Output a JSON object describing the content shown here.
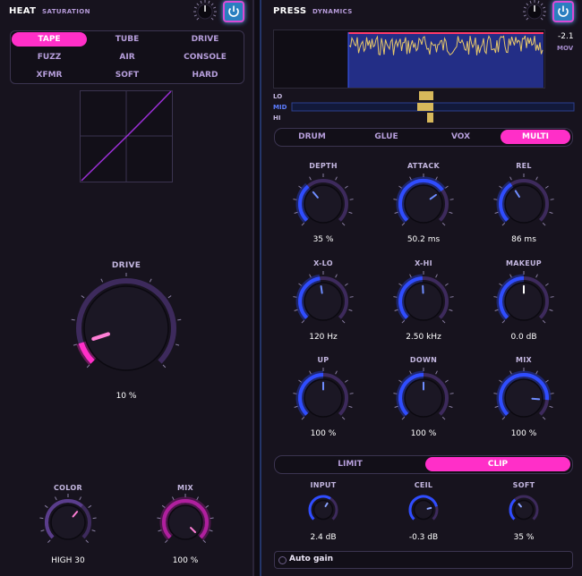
{
  "heat": {
    "title": "HEAT",
    "subtitle": "SATURATION",
    "modes": [
      "TAPE",
      "TUBE",
      "DRIVE",
      "FUZZ",
      "AIR",
      "CONSOLE",
      "XFMR",
      "SOFT",
      "HARD"
    ],
    "active_mode": "TAPE",
    "drive": {
      "label": "DRIVE",
      "value": "10 %",
      "level": 0.1
    },
    "color": {
      "label": "COLOR",
      "value": "HIGH 30",
      "level": 0.65
    },
    "mix": {
      "label": "MIX",
      "value": "100 %",
      "level": 1.0
    }
  },
  "press": {
    "title": "PRESS",
    "subtitle": "DYNAMICS",
    "readout": {
      "value": "-2.1",
      "unit": "MOV"
    },
    "bands": [
      "LO",
      "MID",
      "HI"
    ],
    "presets": [
      "DRUM",
      "GLUE",
      "VOX",
      "MULTI"
    ],
    "active_preset": "MULTI",
    "knobs": [
      {
        "label": "DEPTH",
        "value": "35 %",
        "level": 0.35
      },
      {
        "label": "ATTACK",
        "value": "50.2 ms",
        "level": 0.7
      },
      {
        "label": "REL",
        "value": "86 ms",
        "level": 0.38
      },
      {
        "label": "X-LO",
        "value": "120 Hz",
        "level": 0.47
      },
      {
        "label": "X-HI",
        "value": "2.50 kHz",
        "level": 0.49
      },
      {
        "label": "MAKEUP",
        "value": "0.0 dB",
        "level": 0.5
      },
      {
        "label": "UP",
        "value": "100 %",
        "level": 0.5
      },
      {
        "label": "DOWN",
        "value": "100 %",
        "level": 0.5
      },
      {
        "label": "MIX",
        "value": "100 %",
        "level": 0.85
      }
    ],
    "modes": [
      "LIMIT",
      "CLIP"
    ],
    "active_mode": "CLIP",
    "small_knobs": [
      {
        "label": "INPUT",
        "value": "2.4 dB",
        "level": 0.62
      },
      {
        "label": "CEIL",
        "value": "-0.3 dB",
        "level": 0.78
      },
      {
        "label": "SOFT",
        "value": "35 %",
        "level": 0.35
      }
    ],
    "auto_gain": "Auto gain"
  },
  "colors": {
    "accent": "#ff2fc8",
    "blue": "#3a5bff",
    "purple": "#7a3fc2",
    "waveform": "#e8c96a"
  }
}
